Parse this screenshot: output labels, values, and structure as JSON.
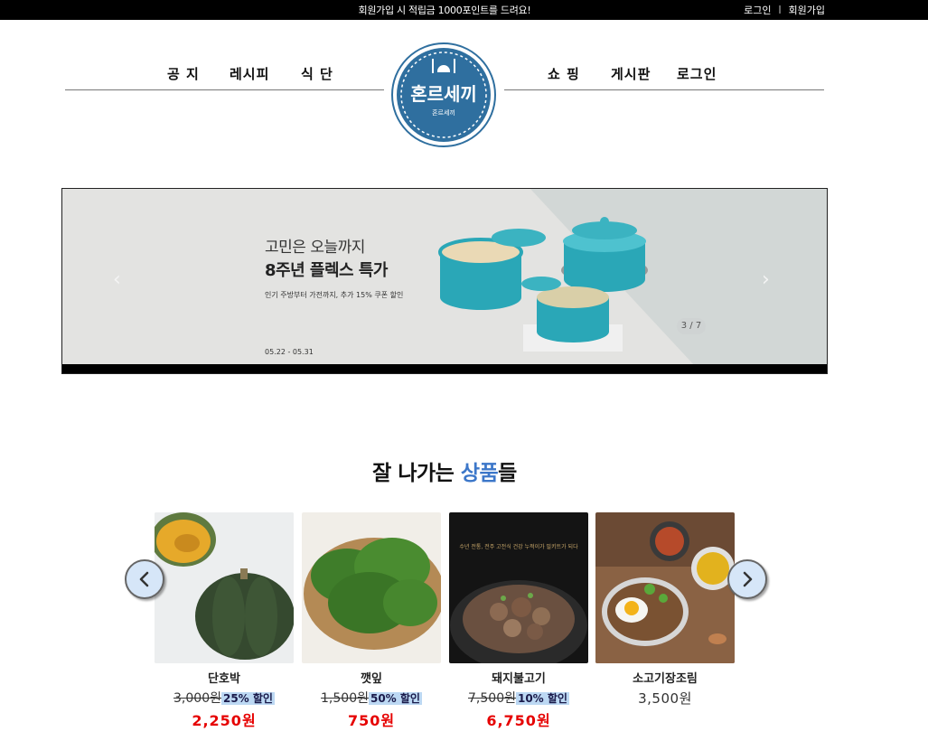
{
  "topbar": {
    "promo": "회원가입 시 적립금 1000포인트를 드려요!",
    "login": "로그인",
    "separator": "|",
    "signup": "회원가입"
  },
  "nav": {
    "left": [
      "공 지",
      "레시피",
      "식 단"
    ],
    "right": [
      "쇼 핑",
      "게시판",
      "로그인"
    ]
  },
  "logo": {
    "title": "혼르세끼",
    "subtitle": "혼르세끼",
    "brand_color": "#2f6f9f"
  },
  "banner": {
    "sub": "고민은 오늘까지",
    "main": "8주년 플렉스 특가",
    "desc": "인기 주방부터 가전까지, 추가 15% 쿠폰 할인",
    "date": "05.22 - 05.31",
    "pager": "3 / 7",
    "prev_icon": "chevron-left-icon",
    "next_icon": "chevron-right-icon"
  },
  "section": {
    "title_before": "잘 나가는 ",
    "title_accent": "상품",
    "title_after": "들",
    "accent_color": "#3c77c9"
  },
  "products": [
    {
      "name": "단호박",
      "original": "3,000원",
      "discount": "25% 할인",
      "sale": "2,250원"
    },
    {
      "name": "깻잎",
      "original": "1,500원",
      "discount": "50% 할인",
      "sale": "750원"
    },
    {
      "name": "돼지불고기",
      "original": "7,500원",
      "discount": "10% 할인",
      "sale": "6,750원",
      "image_caption": "수년 전통, 전주 고전식 건강 누적이가 밀키트가 되다"
    },
    {
      "name": "소고기장조림",
      "price": "3,500원"
    }
  ],
  "carousel": {
    "prev_icon": "chevron-left-icon",
    "next_icon": "chevron-right-icon"
  }
}
